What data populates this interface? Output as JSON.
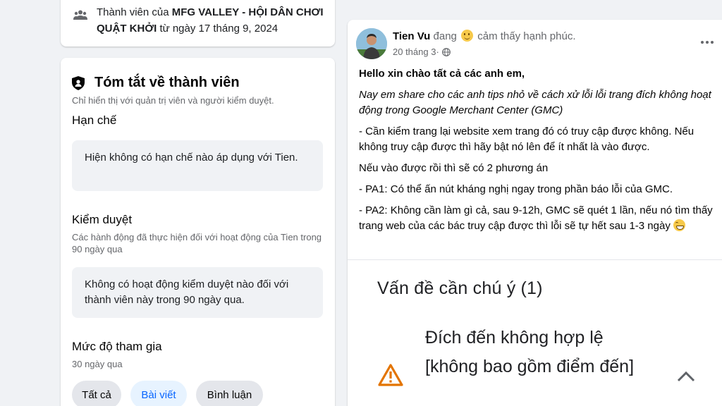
{
  "membership": {
    "prefix": "Thành viên của ",
    "group_name": "MFG VALLEY - HỘI DÂN CHƠI QUẬT KHỞI",
    "suffix": " từ ngày 17 tháng 9, 2024",
    "icon": "people-icon"
  },
  "summary": {
    "title": "Tóm tắt về thành viên",
    "subtitle": "Chỉ hiển thị với quản trị viên và người kiểm duyệt.",
    "restriction": {
      "title": "Hạn chế",
      "box_text": "Hiện không có hạn chế nào áp dụng với Tien."
    },
    "moderation": {
      "title": "Kiểm duyệt",
      "desc": "Các hành động đã thực hiện đối với hoạt động của Tien trong 90 ngày qua",
      "box_text": "Không có hoạt động kiểm duyệt nào đối với thành viên này trong 90 ngày qua."
    },
    "engagement": {
      "title": "Mức độ tham gia",
      "desc": "30 ngày qua",
      "filters": [
        {
          "label": "Tất cả",
          "active": false
        },
        {
          "label": "Bài viết",
          "active": true
        },
        {
          "label": "Bình luận",
          "active": false
        }
      ]
    }
  },
  "post": {
    "author": "Tien Vu",
    "feeling_pre": " đang ",
    "feeling_post": " cảm thấy hạnh phúc.",
    "date": "20 tháng 3",
    "separator": " · ",
    "privacy_icon": "globe-icon",
    "greeting": "Hello xin chào tất cả các anh em,",
    "intro": "Nay em share cho các anh tips nhỏ về cách xử lỗi lỗi trang đích không hoạt động trong Google Merchant Center (GMC)",
    "p1": "- Cần kiểm trang lại website xem trang đó có truy cập được không. Nếu không truy cập được thì hãy bật nó lên để ít nhất là vào được.",
    "p2": "Nếu vào được rồi thì sẽ có 2 phương án",
    "p3": "- PA1: Có thể ấn nút kháng nghị ngay trong phần báo lỗi của GMC.",
    "p4": "- PA2: Không cần làm gì cả, sau 9-12h, GMC sẽ quét 1 lần, nếu nó tìm thấy trang web của các bác truy cập được thì lỗi sẽ tự hết sau 1-3 ngày",
    "image": {
      "heading": "Vấn đề cần chú ý (1)",
      "issue": "Đích đến không hợp lệ [không bao gồm điểm đến]"
    }
  },
  "colors": {
    "accent": "#0866ff",
    "warning": "#e37400"
  }
}
